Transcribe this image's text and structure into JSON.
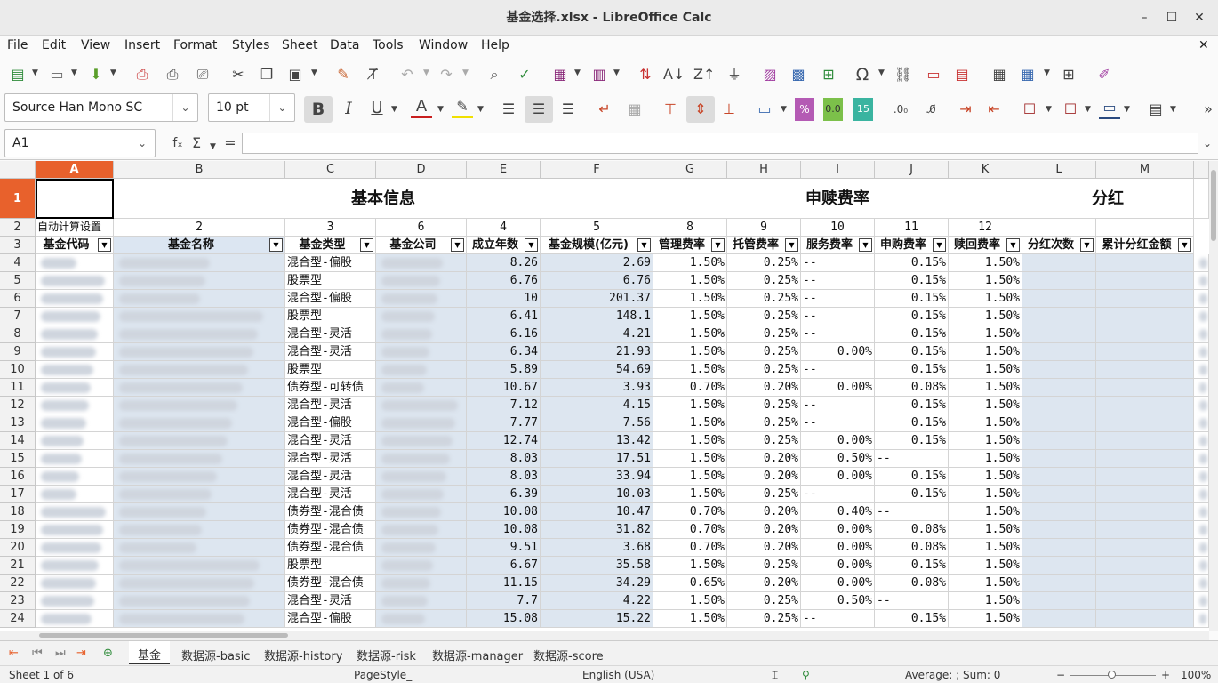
{
  "window": {
    "title": "基金选择.xlsx - LibreOffice Calc",
    "minimize": "–",
    "maximize": "☐",
    "close": "✕",
    "doc_close": "✕"
  },
  "menu": [
    "File",
    "Edit",
    "View",
    "Insert",
    "Format",
    "Styles",
    "Sheet",
    "Data",
    "Tools",
    "Window",
    "Help"
  ],
  "font": {
    "name": "Source Han Mono SC",
    "size": "10 pt"
  },
  "formula": {
    "cell_ref": "A1",
    "fx": "fₓ",
    "sum": "Σ",
    "eq": "="
  },
  "columns": [
    "A",
    "B",
    "C",
    "D",
    "E",
    "F",
    "G",
    "H",
    "I",
    "J",
    "K",
    "L",
    "M"
  ],
  "row1": {
    "group1": "基本信息",
    "group2": "申赎费率",
    "group3": "分红"
  },
  "row2": {
    "a": "自动计算设置",
    "b": "2",
    "c": "3",
    "d": "6",
    "e": "4",
    "f": "5",
    "g": "8",
    "h": "9",
    "i": "10",
    "j": "11",
    "k": "12"
  },
  "headers": [
    "基金代码",
    "基金名称",
    "基金类型",
    "基金公司",
    "成立年数",
    "基金规模(亿元)",
    "管理费率",
    "托管费率",
    "服务费率",
    "申购费率",
    "赎回费率",
    "分红次数",
    "累计分红金额"
  ],
  "rows": [
    {
      "n": "4",
      "type": "混合型-偏股",
      "years": "8.26",
      "size": "2.69",
      "mgmt": "1.50%",
      "cust": "0.25%",
      "svc": "--",
      "sub": "0.15%",
      "red": "1.50%"
    },
    {
      "n": "5",
      "type": "股票型",
      "years": "6.76",
      "size": "6.76",
      "mgmt": "1.50%",
      "cust": "0.25%",
      "svc": "--",
      "sub": "0.15%",
      "red": "1.50%"
    },
    {
      "n": "6",
      "type": "混合型-偏股",
      "years": "10",
      "size": "201.37",
      "mgmt": "1.50%",
      "cust": "0.25%",
      "svc": "--",
      "sub": "0.15%",
      "red": "1.50%"
    },
    {
      "n": "7",
      "type": "股票型",
      "years": "6.41",
      "size": "148.1",
      "mgmt": "1.50%",
      "cust": "0.25%",
      "svc": "--",
      "sub": "0.15%",
      "red": "1.50%"
    },
    {
      "n": "8",
      "type": "混合型-灵活",
      "years": "6.16",
      "size": "4.21",
      "mgmt": "1.50%",
      "cust": "0.25%",
      "svc": "--",
      "sub": "0.15%",
      "red": "1.50%"
    },
    {
      "n": "9",
      "type": "混合型-灵活",
      "years": "6.34",
      "size": "21.93",
      "mgmt": "1.50%",
      "cust": "0.25%",
      "svc": "0.00%",
      "sub": "0.15%",
      "red": "1.50%"
    },
    {
      "n": "10",
      "type": "股票型",
      "years": "5.89",
      "size": "54.69",
      "mgmt": "1.50%",
      "cust": "0.25%",
      "svc": "--",
      "sub": "0.15%",
      "red": "1.50%"
    },
    {
      "n": "11",
      "type": "债券型-可转债",
      "years": "10.67",
      "size": "3.93",
      "mgmt": "0.70%",
      "cust": "0.20%",
      "svc": "0.00%",
      "sub": "0.08%",
      "red": "1.50%"
    },
    {
      "n": "12",
      "type": "混合型-灵活",
      "years": "7.12",
      "size": "4.15",
      "mgmt": "1.50%",
      "cust": "0.25%",
      "svc": "--",
      "sub": "0.15%",
      "red": "1.50%"
    },
    {
      "n": "13",
      "type": "混合型-偏股",
      "years": "7.77",
      "size": "7.56",
      "mgmt": "1.50%",
      "cust": "0.25%",
      "svc": "--",
      "sub": "0.15%",
      "red": "1.50%"
    },
    {
      "n": "14",
      "type": "混合型-灵活",
      "years": "12.74",
      "size": "13.42",
      "mgmt": "1.50%",
      "cust": "0.25%",
      "svc": "0.00%",
      "sub": "0.15%",
      "red": "1.50%"
    },
    {
      "n": "15",
      "type": "混合型-灵活",
      "years": "8.03",
      "size": "17.51",
      "mgmt": "1.50%",
      "cust": "0.20%",
      "svc": "0.50%",
      "sub": "--",
      "red": "1.50%"
    },
    {
      "n": "16",
      "type": "混合型-灵活",
      "years": "8.03",
      "size": "33.94",
      "mgmt": "1.50%",
      "cust": "0.20%",
      "svc": "0.00%",
      "sub": "0.15%",
      "red": "1.50%"
    },
    {
      "n": "17",
      "type": "混合型-灵活",
      "years": "6.39",
      "size": "10.03",
      "mgmt": "1.50%",
      "cust": "0.25%",
      "svc": "--",
      "sub": "0.15%",
      "red": "1.50%"
    },
    {
      "n": "18",
      "type": "债券型-混合债",
      "years": "10.08",
      "size": "10.47",
      "mgmt": "0.70%",
      "cust": "0.20%",
      "svc": "0.40%",
      "sub": "--",
      "red": "1.50%"
    },
    {
      "n": "19",
      "type": "债券型-混合债",
      "years": "10.08",
      "size": "31.82",
      "mgmt": "0.70%",
      "cust": "0.20%",
      "svc": "0.00%",
      "sub": "0.08%",
      "red": "1.50%"
    },
    {
      "n": "20",
      "type": "债券型-混合债",
      "years": "9.51",
      "size": "3.68",
      "mgmt": "0.70%",
      "cust": "0.20%",
      "svc": "0.00%",
      "sub": "0.08%",
      "red": "1.50%"
    },
    {
      "n": "21",
      "type": "股票型",
      "years": "6.67",
      "size": "35.58",
      "mgmt": "1.50%",
      "cust": "0.25%",
      "svc": "0.00%",
      "sub": "0.15%",
      "red": "1.50%"
    },
    {
      "n": "22",
      "type": "债券型-混合债",
      "years": "11.15",
      "size": "34.29",
      "mgmt": "0.65%",
      "cust": "0.20%",
      "svc": "0.00%",
      "sub": "0.08%",
      "red": "1.50%"
    },
    {
      "n": "23",
      "type": "混合型-灵活",
      "years": "7.7",
      "size": "4.22",
      "mgmt": "1.50%",
      "cust": "0.25%",
      "svc": "0.50%",
      "sub": "--",
      "red": "1.50%"
    },
    {
      "n": "24",
      "type": "混合型-偏股",
      "years": "15.08",
      "size": "15.22",
      "mgmt": "1.50%",
      "cust": "0.25%",
      "svc": "--",
      "sub": "0.15%",
      "red": "1.50%"
    }
  ],
  "tabs": [
    "基金",
    "数据源-basic",
    "数据源-history",
    "数据源-risk",
    "数据源-manager",
    "数据源-score"
  ],
  "status": {
    "sheet": "Sheet 1 of 6",
    "style": "PageStyle_",
    "lang": "English (USA)",
    "calc": "Average: ; Sum: 0",
    "zoom": "100%"
  },
  "colors": {
    "accent": "#e8612c",
    "selected_col": "#dce6f2",
    "blue_fill": "#dde6f0"
  }
}
